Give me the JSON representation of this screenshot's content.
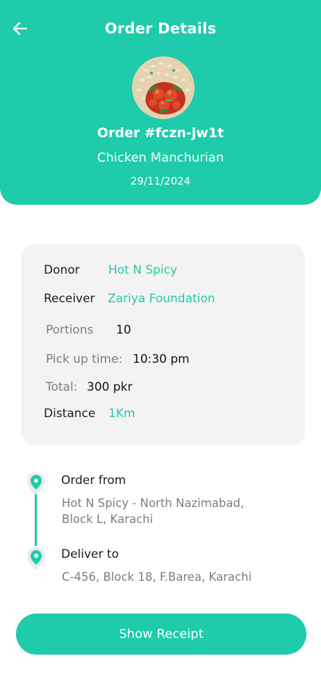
{
  "header": {
    "title": "Order Details",
    "order_id": "Order #fczn-jw1t",
    "dish": "Chicken Manchurian",
    "date": "29/11/2024",
    "back_icon": "arrow-left-icon",
    "accent_color": "#1ECBAA"
  },
  "details": {
    "donor_label": "Donor",
    "donor_value": "Hot N Spicy",
    "receiver_label": "Receiver",
    "receiver_value": "Zariya Foundation",
    "portions_label": "Portions",
    "portions_value": "10",
    "pickup_label": "Pick up time:",
    "pickup_value": "10:30 pm",
    "total_label": "Total:",
    "total_value": "300 pkr",
    "distance_label": "Distance",
    "distance_value": "1Km"
  },
  "route": {
    "from_title": "Order from",
    "from_address_line1": "Hot N Spicy - North Nazimabad,",
    "from_address_line2": "Block L, Karachi",
    "to_title": "Deliver to",
    "to_address": "C-456, Block 18, F.Barea, Karachi",
    "pin_icon": "location-pin-icon"
  },
  "actions": {
    "receipt_label": "Show Receipt"
  }
}
